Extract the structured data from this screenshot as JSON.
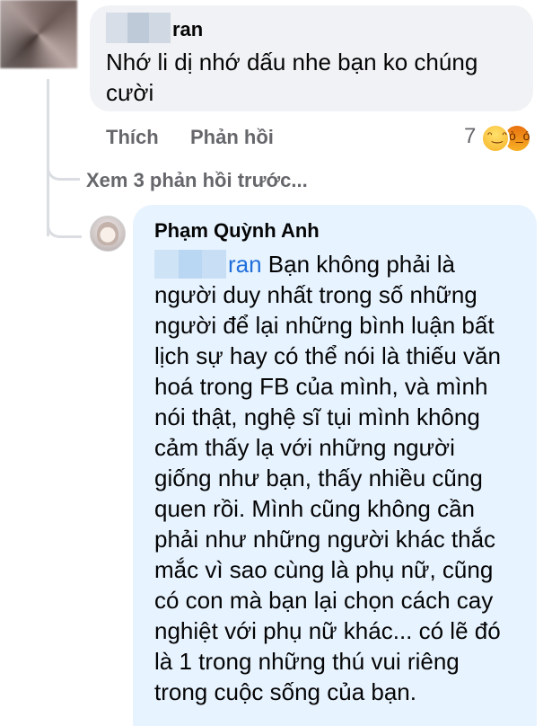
{
  "comment1": {
    "author_visible": "ran",
    "text_lines": [
      "Nhớ li dị nhớ dấu nhe bạn ko chúng",
      "cười"
    ],
    "actions": {
      "like": "Thích",
      "reply": "Phản hồi"
    },
    "reaction_count": "7",
    "reactions": [
      "haha-icon",
      "angry-icon"
    ]
  },
  "thread": {
    "view_previous": "Xem 3 phản hồi trước..."
  },
  "comment2": {
    "author": "Phạm Quỳnh Anh",
    "mention_visible": "ran",
    "first_line_rest": " Bạn không phải là",
    "text_lines": [
      "người duy nhất trong số những",
      "người để lại những bình luận bất",
      "lịch sự hay có thể nói là thiếu văn",
      "hoá trong FB của mình, và mình",
      "nói thật, nghệ sĩ tụi mình không",
      "cảm thấy lạ với những người",
      "giống như bạn, thấy nhiều cũng",
      "quen rồi. Mình cũng không cần",
      "phải như những người khác thắc",
      "mắc vì sao cùng là phụ nữ, cũng",
      "có con mà bạn lại chọn cách cay",
      "nghiệt với phụ nữ khác... có lẽ đó",
      "là 1 trong những thú vui riêng",
      "trong cuộc sống của bạn."
    ]
  },
  "colors": {
    "bubble_grey": "#f0f2f5",
    "bubble_blue": "#e7f3ff",
    "meta_grey": "#65676b",
    "mention_blue": "#216fdb"
  }
}
